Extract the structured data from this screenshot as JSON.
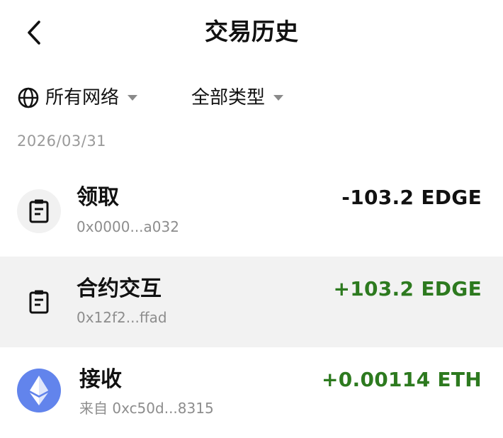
{
  "header": {
    "title": "交易历史",
    "back_icon": "chevron-left-icon"
  },
  "filters": {
    "network": {
      "label": "所有网络",
      "icon": "globe-icon"
    },
    "type": {
      "label": "全部类型"
    }
  },
  "date_group": "2026/03/31",
  "transactions": [
    {
      "name": "领取",
      "address": "0x0000...a032",
      "amount": "-103.2 EDGE",
      "amount_color": "#111111",
      "icon": "clipboard-icon",
      "selected": false
    },
    {
      "name": "合约交互",
      "address": "0x12f2...ffad",
      "amount": "+103.2 EDGE",
      "amount_color": "#2d7a1f",
      "icon": "clipboard-icon",
      "selected": true
    },
    {
      "name": "接收",
      "address": "来自 0xc50d...8315",
      "amount": "+0.00114 ETH",
      "amount_color": "#2d7a1f",
      "icon": "ethereum-icon",
      "selected": false
    }
  ],
  "colors": {
    "positive": "#2d7a1f",
    "negative": "#111111",
    "selected_row_bg": "#f2f2f2",
    "eth_icon_bg": "#6284ec"
  }
}
